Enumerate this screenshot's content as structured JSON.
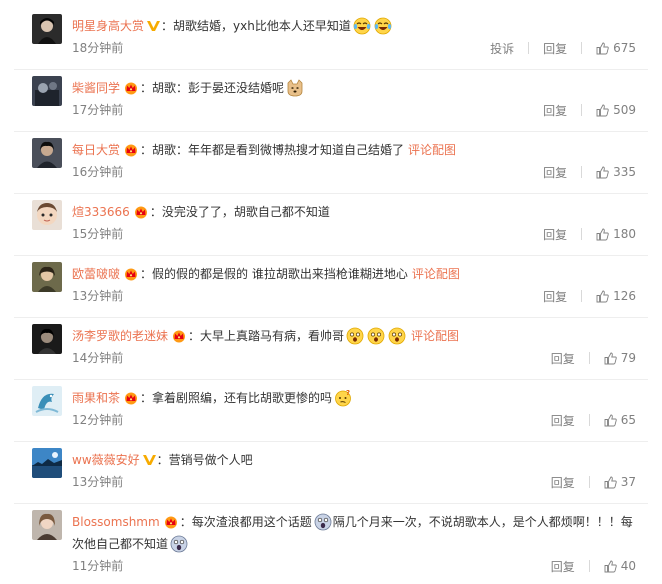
{
  "colors": {
    "username": "#eb7350",
    "text": "#333333",
    "meta": "#808080",
    "divider": "#eeeeee"
  },
  "comments": [
    {
      "user": "明星身高大赏",
      "badge": "verified-v-icon",
      "text_before": "：胡歌结婚，yxh比他本人还早知道",
      "emojis": [
        "laughing-tears-emoji-icon",
        "laughing-tears-emoji-icon"
      ],
      "time": "18分钟前",
      "report": "投诉",
      "reply": "回复",
      "likes": "675"
    },
    {
      "user": "柴酱同学",
      "badge": "crown-member-icon",
      "text_before": "：胡歌：彭于晏还没结婚呢",
      "emojis": [
        "doge-emoji-icon"
      ],
      "time": "17分钟前",
      "reply": "回复",
      "likes": "509"
    },
    {
      "user": "每日大赏",
      "badge": "crown-member-icon",
      "text_before": "：胡歌：年年都是看到微博热搜才知道自己结婚了",
      "link": "评论配图",
      "time": "16分钟前",
      "reply": "回复",
      "likes": "335"
    },
    {
      "user": "煊333666",
      "badge": "crown-member-icon",
      "text_before": "：没完没了了，胡歌自己都不知道",
      "time": "15分钟前",
      "reply": "回复",
      "likes": "180"
    },
    {
      "user": "欧蕾啵啵",
      "badge": "crown-member-icon",
      "text_before": "：假的假的都是假的 谁拉胡歌出来挡枪谁糊进地心",
      "link": "评论配图",
      "time": "13分钟前",
      "reply": "回复",
      "likes": "126"
    },
    {
      "user": "汤李罗歌的老迷妹",
      "badge": "crown-member-icon",
      "text_before": "：大早上真踏马有病，看帅哥",
      "emojis": [
        "shocked-face-emoji-icon",
        "shocked-face-emoji-icon",
        "shocked-face-emoji-icon"
      ],
      "link": "评论配图",
      "time": "14分钟前",
      "reply": "回复",
      "likes": "79"
    },
    {
      "user": "雨果和茶",
      "badge": "crown-member-icon",
      "text_before": "：拿着剧照编，还有比胡歌更惨的吗",
      "emojis": [
        "puzzled-face-emoji-icon"
      ],
      "time": "12分钟前",
      "reply": "回复",
      "likes": "65"
    },
    {
      "user": "ww薇薇安好",
      "badge": "verified-v-icon",
      "text_before": "：营销号做个人吧",
      "time": "13分钟前",
      "reply": "回复",
      "likes": "37"
    },
    {
      "user": "Blossomshmm",
      "badge": "crown-member-icon",
      "text_before": "：每次渣浪都用这个话题",
      "text_middle": "隔几个月来一次，不说胡歌本人，是个人都烦啊！！！每次他自己都不知道",
      "emojis": [
        "terrified-face-emoji-icon",
        "terrified-face-emoji-icon"
      ],
      "time": "11分钟前",
      "reply": "回复",
      "likes": "40"
    }
  ]
}
